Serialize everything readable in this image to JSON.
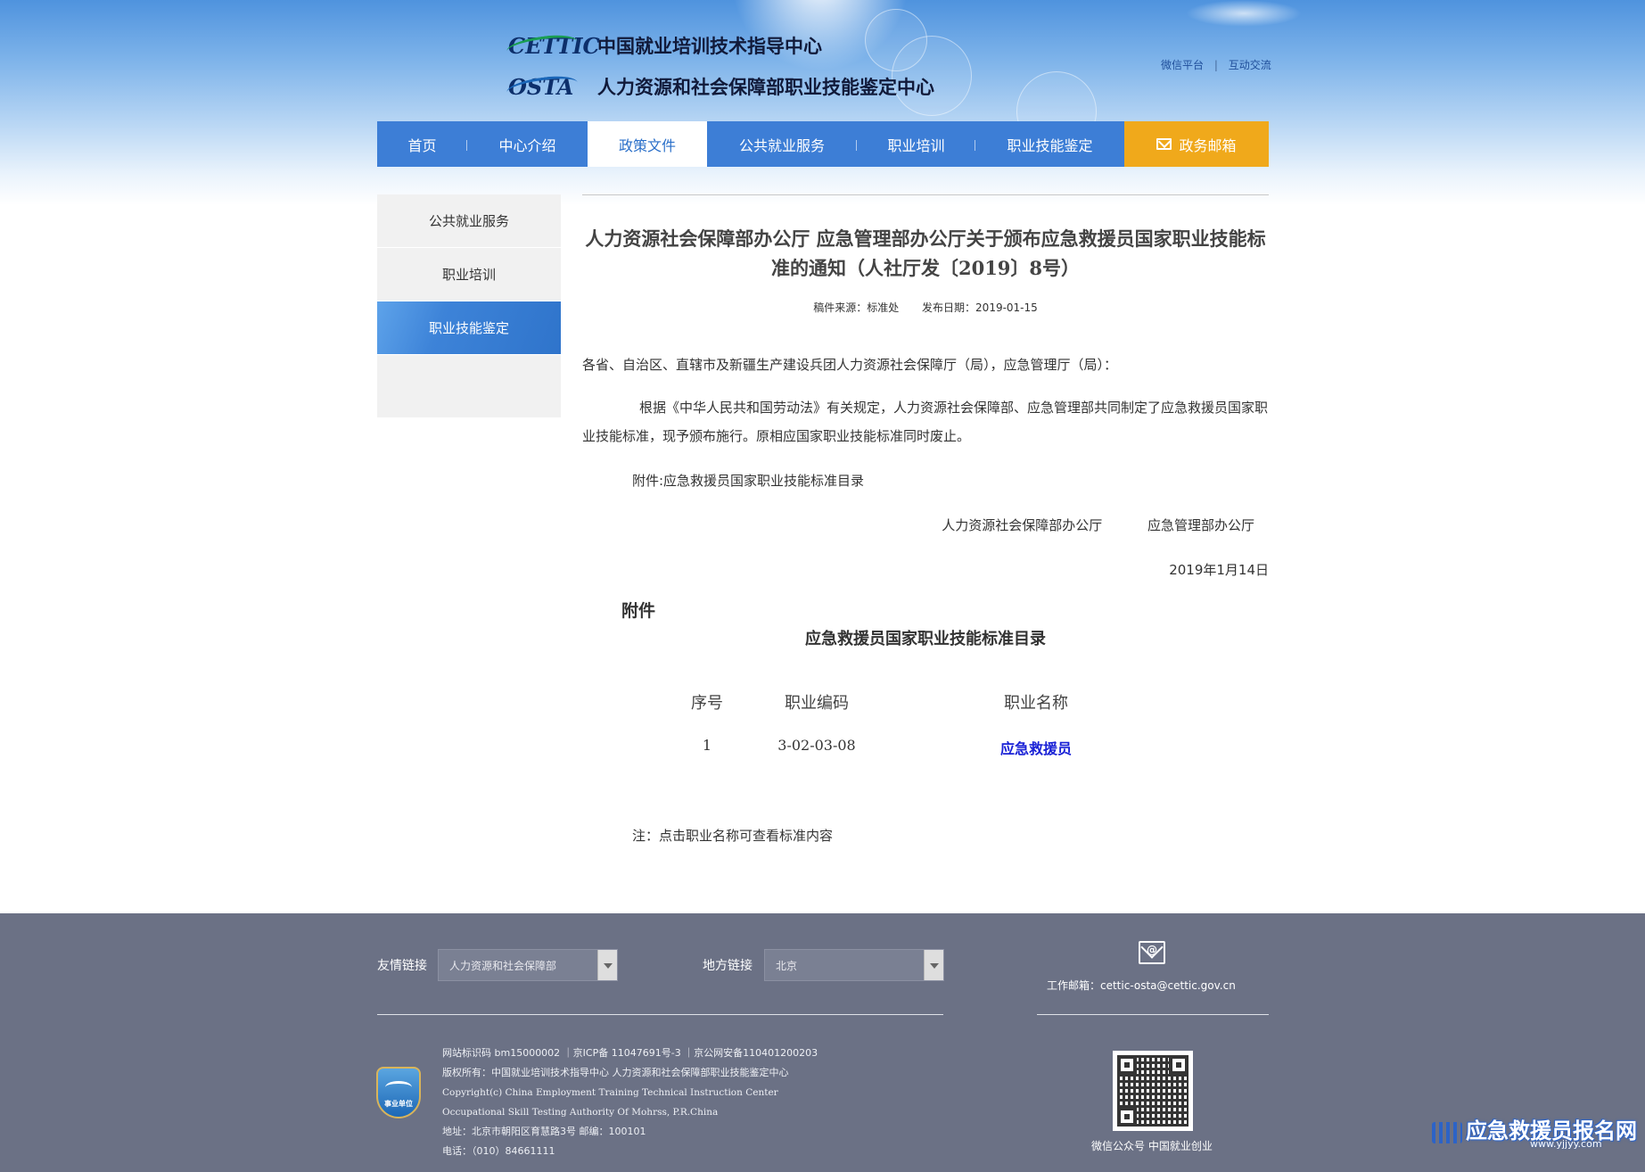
{
  "header": {
    "logo1_mark": "CETTIC",
    "logo1_text": "中国就业培训技术指导中心",
    "logo2_mark": "OSTA",
    "logo2_text": "人力资源和社会保障部职业技能鉴定中心",
    "top_links": [
      "微信平台",
      "互动交流"
    ],
    "top_link_separator": "|"
  },
  "nav": {
    "items": [
      {
        "label": "首页"
      },
      {
        "label": "中心介绍"
      },
      {
        "label": "政策文件",
        "active": true
      },
      {
        "label": "公共就业服务"
      },
      {
        "label": "职业培训"
      },
      {
        "label": "职业技能鉴定"
      }
    ],
    "mail_label": "政务邮箱",
    "colors": {
      "nav_bg": "#3d7ed6",
      "mail_bg": "#f0a91b"
    }
  },
  "sidebar": {
    "items": [
      {
        "label": "公共就业服务"
      },
      {
        "label": "职业培训"
      },
      {
        "label": "职业技能鉴定",
        "active": true
      }
    ]
  },
  "article": {
    "title": "人力资源社会保障部办公厅 应急管理部办公厅关于颁布应急救援员国家职业技能标准的通知（人社厅发〔2019〕8号）",
    "source": "稿件来源：标准处",
    "publish_date": "发布日期：2019-01-15",
    "salutation": "各省、自治区、直辖市及新疆生产建设兵团人力资源社会保障厅（局），应急管理厅（局）：",
    "body": "根据《中华人民共和国劳动法》有关规定，人力资源社会保障部、应急管理部共同制定了应急救援员国家职业技能标准，现予颁布施行。原相应国家职业技能标准同时废止。",
    "attachment_line": "附件:应急救援员国家职业技能标准目录",
    "signers": [
      "人力资源社会保障部办公厅",
      "应急管理部办公厅"
    ],
    "sign_date": "2019年1月14日",
    "attachment_label": "附件",
    "attachment_title": "应急救援员国家职业技能标准目录",
    "table": {
      "headers": [
        "序号",
        "职业编码",
        "职业名称"
      ],
      "rows": [
        [
          "1",
          "3-02-03-08",
          "应急救援员"
        ]
      ]
    },
    "note": "注：点击职业名称可查看标准内容"
  },
  "footer": {
    "friend_links_label": "友情链接",
    "friend_links_value": "人力资源和社会保障部",
    "local_links_label": "地方链接",
    "local_links_value": "北京",
    "email": "工作邮箱：cettic-osta@cettic.gov.cn",
    "badge_text": "事业单位",
    "info_lines": [
      "网站标识码 bm15000002 ｜京ICP备 11047691号-3 ｜京公网安备110401200203",
      "版权所有：中国就业培训技术指导中心 人力资源和社会保障部职业技能鉴定中心",
      "Copyright(c) China Employment Training Technical Instruction Center",
      "Occupational Skill Testing Authority Of Mohrss, P.R.China",
      "地址：北京市朝阳区育慧路3号 邮编：100101",
      "电话：（010）84661111"
    ],
    "wechat_label": "微信公众号 中国就业创业",
    "watermark": "应急救援员报名网",
    "watermark_url": "www.yjjyy.com"
  }
}
